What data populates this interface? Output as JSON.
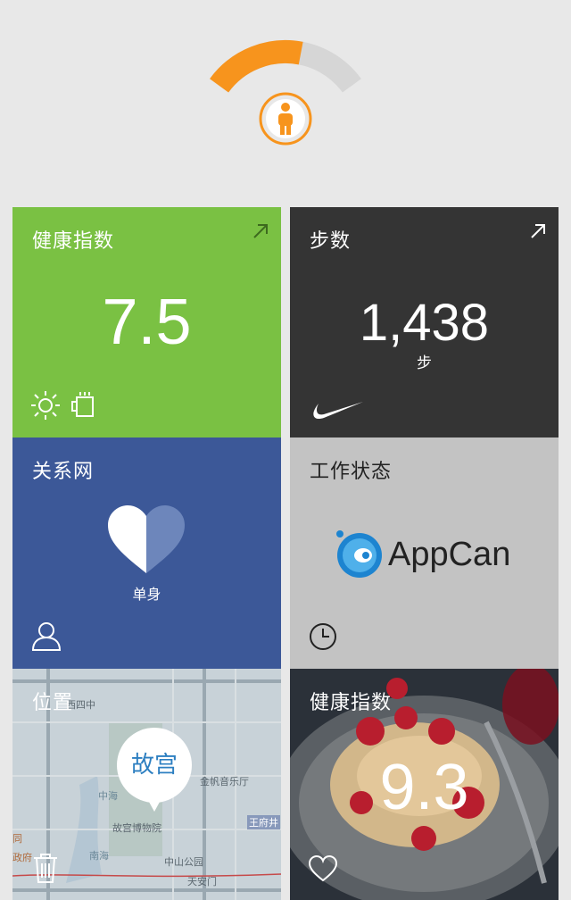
{
  "gauge": {
    "progress": 0.6,
    "fill_color": "#f7941d",
    "track_color": "#d6d6d6",
    "icon": "person-icon"
  },
  "tiles": {
    "health": {
      "title": "健康指数",
      "value": "7.5",
      "bg": "#7ac143",
      "icons": [
        "sun-icon",
        "coffee-cup-icon"
      ],
      "corner_icon": "expand-arrow-icon"
    },
    "steps": {
      "title": "步数",
      "value": "1,438",
      "unit": "步",
      "bg": "#343434",
      "brand_icon": "nike-swoosh-icon",
      "corner_icon": "expand-arrow-icon"
    },
    "relationship": {
      "title": "关系网",
      "status": "单身",
      "bg": "#3c5898",
      "icons": [
        "heart-icon",
        "user-icon"
      ]
    },
    "work": {
      "title": "工作状态",
      "logo_text": "AppCan",
      "bg": "#c3c3c3",
      "icons": [
        "appcan-logo-icon",
        "clock-icon"
      ]
    },
    "location": {
      "title": "位置",
      "place": "故宫",
      "map_labels": [
        "西四中",
        "金帆音乐厅",
        "中海",
        "故宫博物院",
        "王府井",
        "南海",
        "中山公园",
        "天安门",
        "同",
        "政府"
      ],
      "icons": [
        "map-pin-bubble",
        "trash-icon"
      ]
    },
    "health2": {
      "title": "健康指数",
      "value": "9.3",
      "icons": [
        "heart-outline-icon"
      ]
    }
  }
}
